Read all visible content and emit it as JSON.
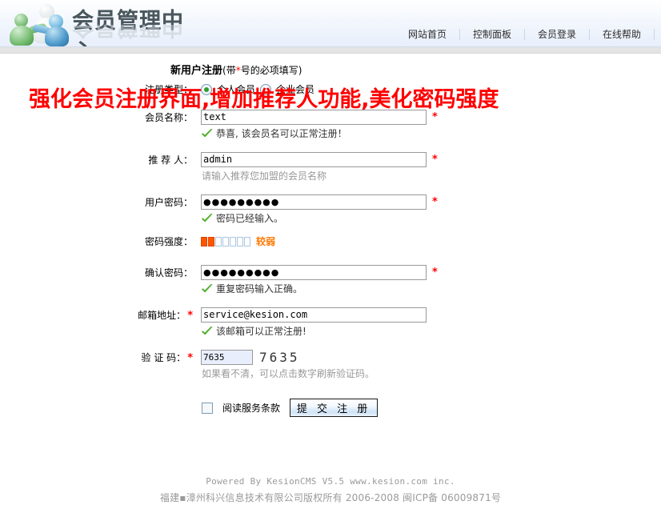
{
  "header": {
    "logo_text": "会员管理中心",
    "logo_icon": "three-people-icon",
    "nav": [
      {
        "label": "网站首页"
      },
      {
        "label": "控制面板"
      },
      {
        "label": "会员登录"
      },
      {
        "label": "在线帮助"
      }
    ]
  },
  "banner": {
    "red_text": "强化会员注册界面,增加推荐人功能,美化密码强度"
  },
  "form": {
    "title_main": "新用户注册",
    "title_sub_pre": "(带",
    "title_sub_star": "*",
    "title_sub_post": "号的必项填写)",
    "required_mark": "*",
    "rows": {
      "regtype": {
        "label": "注册类型：",
        "options": [
          {
            "label": "个人会员",
            "selected": true
          },
          {
            "label": "企业会员",
            "selected": false
          }
        ]
      },
      "username": {
        "label": "会员名称：",
        "value": "text",
        "placeholder": "",
        "hint": "恭喜, 该会员名可以正常注册！",
        "hint_icon": "green-check-icon",
        "required": true
      },
      "referrer": {
        "label": "推 荐 人：",
        "value": "admin",
        "placeholder": "",
        "hint": "请输入推荐您加盟的会员名称",
        "hint_icon": "none",
        "required": true
      },
      "password": {
        "label": "用户密码：",
        "value": "●●●●●●●●●",
        "hint": "密码已经输入。",
        "hint_icon": "green-check-icon",
        "required": true
      },
      "strength": {
        "label": "密码强度：",
        "filled_blocks": 2,
        "empty_blocks": 5,
        "level_text": "较弱",
        "on_color": "#ff5500",
        "off_color": "#a9c6e0",
        "text_color": "#ff7700"
      },
      "confirm": {
        "label": "确认密码：",
        "value": "●●●●●●●●●",
        "hint": "重复密码输入正确。",
        "hint_icon": "green-check-icon",
        "required": true
      },
      "email": {
        "label": "邮箱地址：",
        "value": "service@kesion.com",
        "hint": "该邮箱可以正常注册!",
        "hint_icon": "green-check-icon",
        "required": true
      },
      "captcha": {
        "label": "验 证 码：",
        "value": "7635",
        "image_text": "7635",
        "hint": "如果看不清，可以点击数字刷新验证码。",
        "hint_icon": "none",
        "required": true
      },
      "agree": {
        "label": "阅读服务条款",
        "checked": false
      },
      "submit": {
        "label": "提 交 注 册"
      }
    }
  },
  "footer": {
    "powered": "Powered By KesionCMS V5.5 www.kesion.com inc.",
    "copyright": "福建▪漳州科兴信息技术有限公司版权所有 2006-2008 闽ICP备 06009871号"
  }
}
